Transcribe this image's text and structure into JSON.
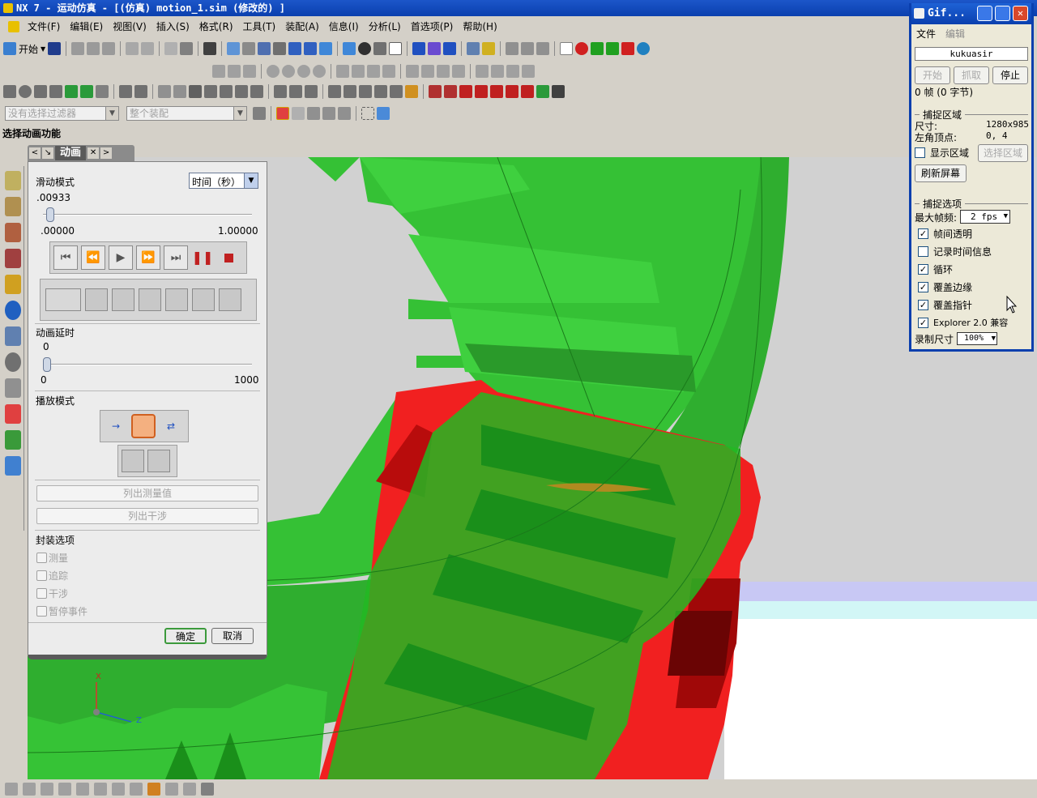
{
  "window": {
    "title": "NX 7 - 运动仿真 - [(仿真) motion_1.sim (修改的) ]"
  },
  "menu": [
    "文件(F)",
    "编辑(E)",
    "视图(V)",
    "插入(S)",
    "格式(R)",
    "工具(T)",
    "装配(A)",
    "信息(I)",
    "分析(L)",
    "首选项(P)",
    "帮助(H)"
  ],
  "toolbar": {
    "start_label": "开始"
  },
  "filters": {
    "selection_filter": "没有选择过滤器",
    "assembly_scope": "整个装配"
  },
  "cue_line": "选择动画功能",
  "dialog": {
    "title": "动画",
    "slide_mode_label": "滑动模式",
    "slide_mode_value": "时间（秒）",
    "time_value": ".00933",
    "time_min": ".00000",
    "time_max": "1.00000",
    "time_fraction": 0.00933,
    "delay_label": "动画延时",
    "delay_value": "0",
    "delay_min": "0",
    "delay_max": "1000",
    "delay_fraction": 0,
    "play_mode_label": "播放模式",
    "list_measure": "列出测量值",
    "list_interference": "列出干涉",
    "packaging_label": "封装选项",
    "packaging": [
      "测量",
      "追踪",
      "干涉",
      "暂停事件"
    ],
    "ok": "确定",
    "cancel": "取消"
  },
  "gif": {
    "title": "Gif...",
    "menu": [
      "文件",
      "编辑"
    ],
    "name": "kukuasir",
    "btn_start": "开始",
    "btn_capture": "抓取",
    "btn_stop": "停止",
    "frames": "0 帧 (0 字节)",
    "capture_region": "捕捉区域",
    "size_label": "尺寸:",
    "size_value": "1280x985",
    "corner_label": "左角顶点:",
    "corner_value": "0, 4",
    "show_region": "显示区域",
    "select_region": "选择区域",
    "refresh": "刷新屏幕",
    "capture_options": "捕捉选项",
    "max_fps_label": "最大帧频:",
    "max_fps_value": "2 fps",
    "options": [
      {
        "label": "帧间透明",
        "checked": true
      },
      {
        "label": "记录时间信息",
        "checked": false
      },
      {
        "label": "循环",
        "checked": true
      },
      {
        "label": "覆盖边缘",
        "checked": true
      },
      {
        "label": "覆盖指针",
        "checked": true
      },
      {
        "label": "Explorer 2.0 兼容",
        "checked": true
      }
    ],
    "record_size_label": "录制尺寸",
    "record_size_value": "100%"
  },
  "axis": {
    "x": "X",
    "z": "Z"
  },
  "colors": {
    "gear_green": "#33cc33",
    "gear_red": "#ff2222",
    "title_blue": "#0a3fae"
  }
}
